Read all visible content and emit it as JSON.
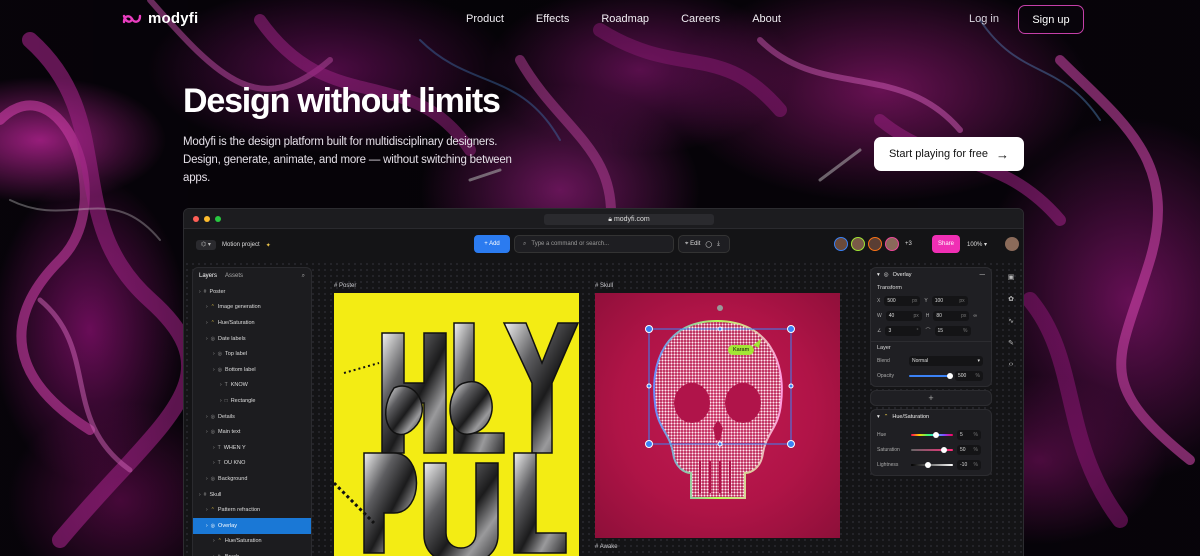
{
  "brand": {
    "name": "modyfi",
    "accent": "#e93ec0"
  },
  "nav": {
    "links": [
      "Product",
      "Effects",
      "Roadmap",
      "Careers",
      "About"
    ],
    "login": "Log in",
    "signup": "Sign up"
  },
  "hero": {
    "title": "Design without limits",
    "description": "Modyfi is the design platform built for multidisciplinary designers. Design, generate, animate, and more — without switching between apps.",
    "cta": "Start playing for free"
  },
  "app": {
    "url": "modyfi.com",
    "project": "Motion project",
    "add_label": "+ Add",
    "command_placeholder": "Type a command or search...",
    "edit_label": "Edit",
    "avatars_extra": "+3",
    "share_label": "Share",
    "zoom": "100%",
    "layers_panel": {
      "tabs": [
        "Layers",
        "Assets"
      ],
      "items": [
        {
          "label": "Poster",
          "indent": 0,
          "icon": "#"
        },
        {
          "label": "Image generation",
          "indent": 1,
          "icon": "fx"
        },
        {
          "label": "Hue/Saturation",
          "indent": 1,
          "icon": "fx"
        },
        {
          "label": "Date labels",
          "indent": 1,
          "icon": "◎"
        },
        {
          "label": "Top label",
          "indent": 2,
          "icon": "◎"
        },
        {
          "label": "Bottom label",
          "indent": 2,
          "icon": "◎"
        },
        {
          "label": "KNOW",
          "indent": 3,
          "icon": "T"
        },
        {
          "label": "Rectangle",
          "indent": 3,
          "icon": "□"
        },
        {
          "label": "Details",
          "indent": 1,
          "icon": "◎"
        },
        {
          "label": "Main text",
          "indent": 1,
          "icon": "◎"
        },
        {
          "label": "WHEN Y",
          "indent": 2,
          "icon": "T"
        },
        {
          "label": "OU KNO",
          "indent": 2,
          "icon": "T"
        },
        {
          "label": "Background",
          "indent": 1,
          "icon": "◎"
        },
        {
          "label": "Skull",
          "indent": 0,
          "icon": "#"
        },
        {
          "label": "Pattern refraction",
          "indent": 1,
          "icon": "fx"
        },
        {
          "label": "Overlay",
          "indent": 1,
          "icon": "◎",
          "selected": true
        },
        {
          "label": "Hue/Saturation",
          "indent": 2,
          "icon": "fx"
        },
        {
          "label": "Brush",
          "indent": 2,
          "icon": "✎"
        }
      ]
    },
    "frames": {
      "poster": "Poster",
      "skull": "Skull",
      "awake": "Awake",
      "cursor_name": "Karam"
    },
    "properties": {
      "overlay_title": "Overlay",
      "transform_title": "Transform",
      "x": "500",
      "y": "100",
      "w": "40",
      "h": "80",
      "rotation": "3",
      "opacity_pct": "15",
      "unit_px": "px",
      "unit_pct": "%",
      "layer_title": "Layer",
      "blend_label": "Blend",
      "blend_value": "Normal",
      "opacity_label": "Opacity",
      "opacity_value": "500",
      "hue_title": "Hue/Saturation",
      "hue_label": "Hue",
      "hue_value": "5",
      "saturation_label": "Saturation",
      "saturation_value": "50",
      "lightness_label": "Lightness",
      "lightness_value": "-10"
    }
  }
}
